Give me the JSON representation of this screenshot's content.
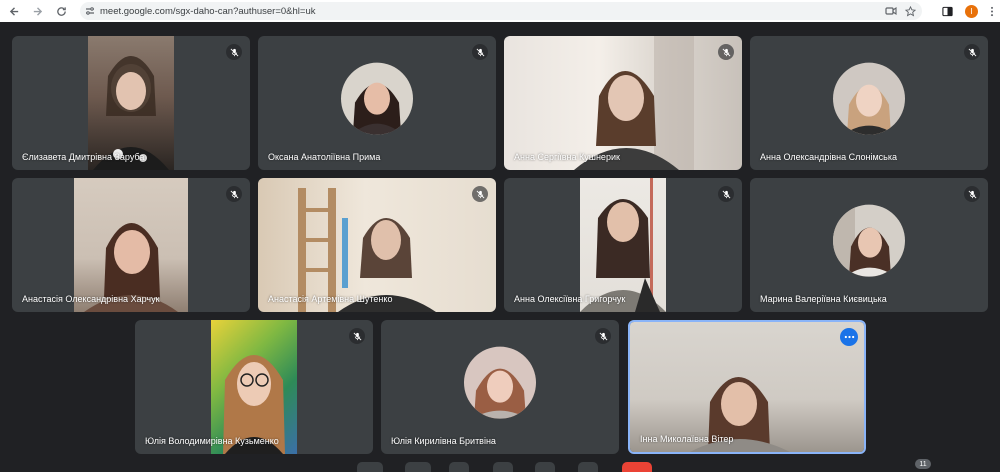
{
  "browser": {
    "url": "meet.google.com/sgx-daho-can?authuser=0&hl=uk",
    "profile_initial": "I",
    "icons": [
      "back-arrow-icon",
      "forward-arrow-icon",
      "reload-icon",
      "site-settings-icon",
      "camera-icon",
      "star-icon",
      "sidebar-icon",
      "menu-icon"
    ]
  },
  "participants": [
    {
      "name": "Єлизавета Дмитрівна Заруба",
      "muted": true
    },
    {
      "name": "Оксана Анатоліївна Прима",
      "muted": true
    },
    {
      "name": "Анна Сергіївна Кушнерик",
      "muted": true
    },
    {
      "name": "Анна Олександрівна Слонімська",
      "muted": true
    },
    {
      "name": "Анастасія Олександрівна Харчук",
      "muted": true
    },
    {
      "name": "Анастасія Артемівна Шутенко",
      "muted": true
    },
    {
      "name": "Анна Олексіївна Григорчук",
      "muted": true
    },
    {
      "name": "Марина Валеріївна Києвицька",
      "muted": true
    },
    {
      "name": "Юлія Володимирівна Кузьменко",
      "muted": true
    },
    {
      "name": "Юлія Кирилівна Бритвіна",
      "muted": true
    },
    {
      "name": "Інна Миколаївна Вітер",
      "muted": false
    }
  ],
  "participant_count": "11",
  "colors": {
    "tile_bg": "#3c4043",
    "stage_bg": "#202124",
    "active_border": "#8ab4f8",
    "accent": "#1a73e8"
  }
}
